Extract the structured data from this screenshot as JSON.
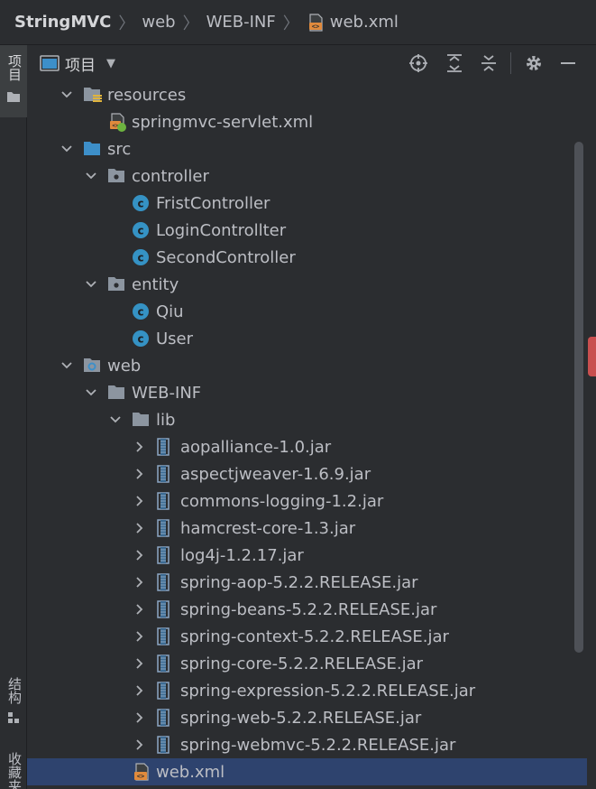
{
  "breadcrumb": {
    "project": "StringMVC",
    "items": [
      "web",
      "WEB-INF",
      "web.xml"
    ]
  },
  "stripe": {
    "top_label": "项目",
    "bottom_label1": "结构",
    "bottom_label2": "收藏夹"
  },
  "toolbar": {
    "title": "项目",
    "actions": [
      "locate-icon",
      "expand-all-icon",
      "collapse-all-icon",
      "gear-icon",
      "minimize-icon"
    ]
  },
  "tree": [
    {
      "label": "resources",
      "depth": 1,
      "arrow": "down",
      "icon": "resources-folder-icon"
    },
    {
      "label": "springmvc-servlet.xml",
      "depth": 2,
      "arrow": "none",
      "icon": "spring-xml-icon"
    },
    {
      "label": "src",
      "depth": 1,
      "arrow": "down",
      "icon": "source-folder-icon"
    },
    {
      "label": "controller",
      "depth": 2,
      "arrow": "down",
      "icon": "package-icon"
    },
    {
      "label": "FristController",
      "depth": 3,
      "arrow": "none",
      "icon": "class-icon"
    },
    {
      "label": "LoginControllter",
      "depth": 3,
      "arrow": "none",
      "icon": "class-icon"
    },
    {
      "label": "SecondController",
      "depth": 3,
      "arrow": "none",
      "icon": "class-icon"
    },
    {
      "label": "entity",
      "depth": 2,
      "arrow": "down",
      "icon": "package-icon"
    },
    {
      "label": "Qiu",
      "depth": 3,
      "arrow": "none",
      "icon": "class-icon"
    },
    {
      "label": "User",
      "depth": 3,
      "arrow": "none",
      "icon": "class-icon"
    },
    {
      "label": "web",
      "depth": 1,
      "arrow": "down",
      "icon": "web-folder-icon"
    },
    {
      "label": "WEB-INF",
      "depth": 2,
      "arrow": "down",
      "icon": "folder-icon"
    },
    {
      "label": "lib",
      "depth": 3,
      "arrow": "down",
      "icon": "folder-icon"
    },
    {
      "label": "aopalliance-1.0.jar",
      "depth": 4,
      "arrow": "right",
      "icon": "jar-icon"
    },
    {
      "label": "aspectjweaver-1.6.9.jar",
      "depth": 4,
      "arrow": "right",
      "icon": "jar-icon"
    },
    {
      "label": "commons-logging-1.2.jar",
      "depth": 4,
      "arrow": "right",
      "icon": "jar-icon"
    },
    {
      "label": "hamcrest-core-1.3.jar",
      "depth": 4,
      "arrow": "right",
      "icon": "jar-icon"
    },
    {
      "label": "log4j-1.2.17.jar",
      "depth": 4,
      "arrow": "right",
      "icon": "jar-icon"
    },
    {
      "label": "spring-aop-5.2.2.RELEASE.jar",
      "depth": 4,
      "arrow": "right",
      "icon": "jar-icon"
    },
    {
      "label": "spring-beans-5.2.2.RELEASE.jar",
      "depth": 4,
      "arrow": "right",
      "icon": "jar-icon"
    },
    {
      "label": "spring-context-5.2.2.RELEASE.jar",
      "depth": 4,
      "arrow": "right",
      "icon": "jar-icon"
    },
    {
      "label": "spring-core-5.2.2.RELEASE.jar",
      "depth": 4,
      "arrow": "right",
      "icon": "jar-icon"
    },
    {
      "label": "spring-expression-5.2.2.RELEASE.jar",
      "depth": 4,
      "arrow": "right",
      "icon": "jar-icon"
    },
    {
      "label": "spring-web-5.2.2.RELEASE.jar",
      "depth": 4,
      "arrow": "right",
      "icon": "jar-icon"
    },
    {
      "label": "spring-webmvc-5.2.2.RELEASE.jar",
      "depth": 4,
      "arrow": "right",
      "icon": "jar-icon"
    },
    {
      "label": "web.xml",
      "depth": 3,
      "arrow": "none",
      "icon": "xml-file-icon",
      "selected": true
    }
  ],
  "colors": {
    "background": "#2b2d30",
    "selection": "#2e436e",
    "text": "#bcbec4",
    "class_icon": "#3592c4",
    "folder": "#8c95a0",
    "source_folder": "#3d8fc9",
    "xml_orange": "#e08a3c"
  }
}
